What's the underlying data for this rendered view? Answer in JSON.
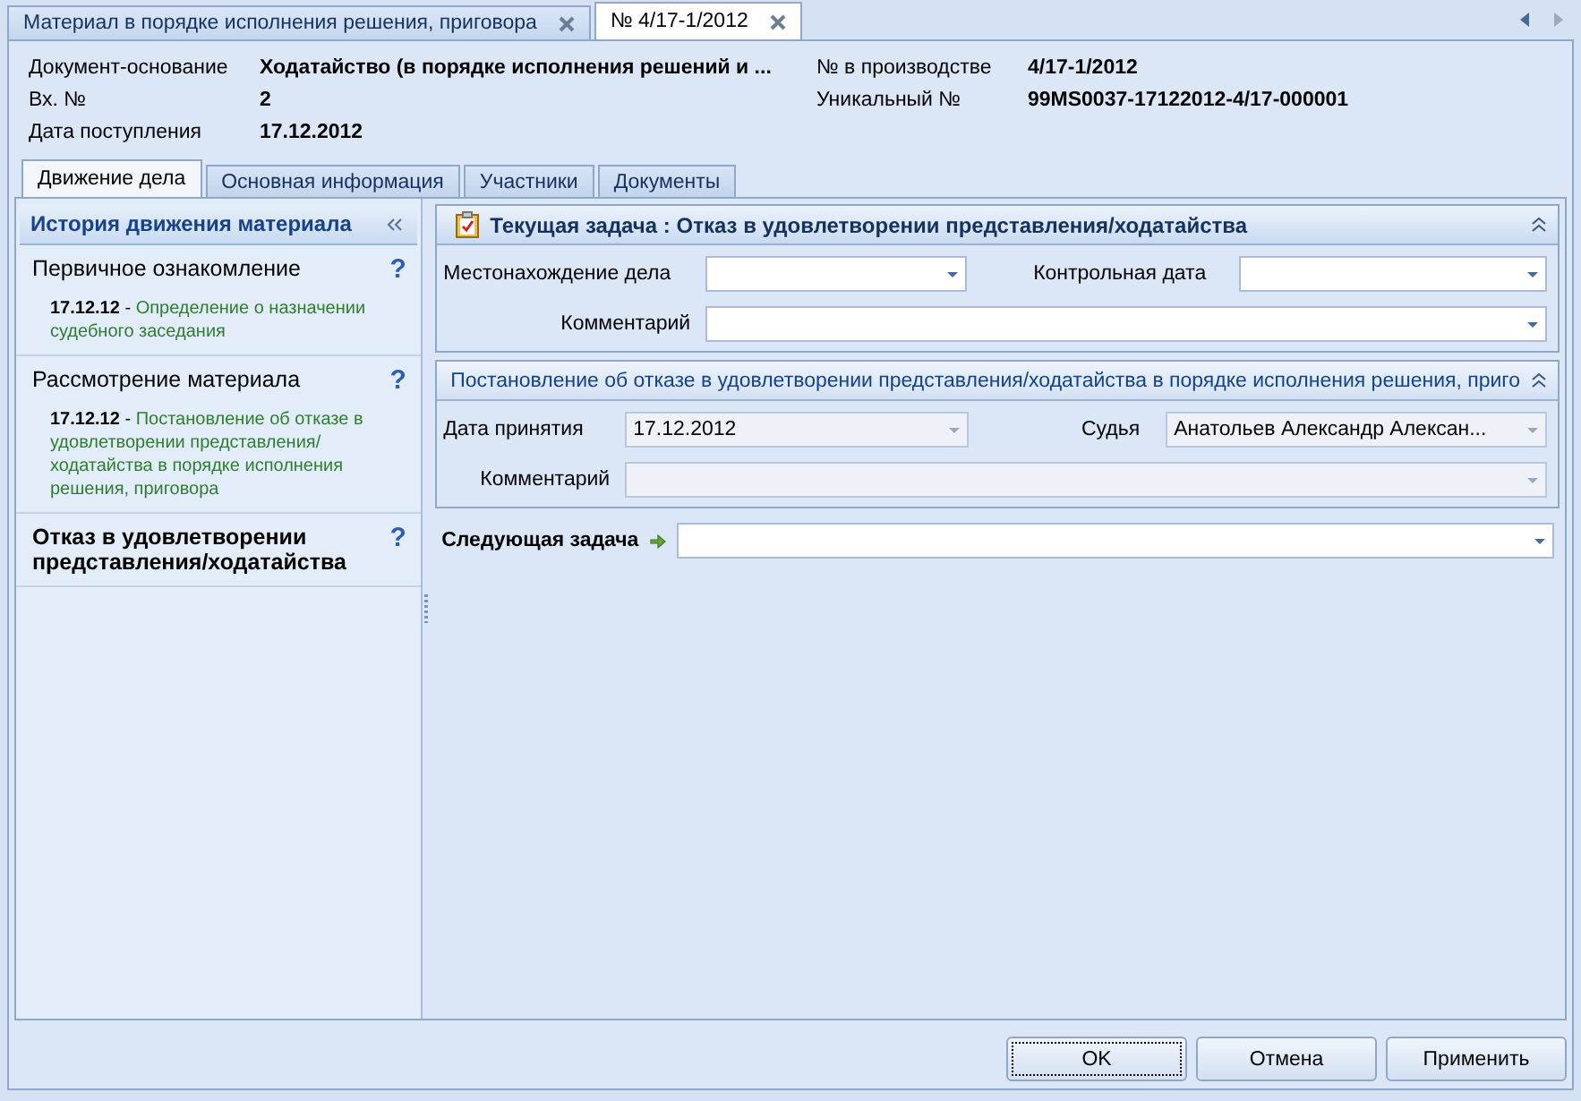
{
  "doc_tabs": [
    {
      "label": "Материал в порядке исполнения решения, приговора",
      "selected": false
    },
    {
      "label": "№ 4/17-1/2012",
      "selected": true
    }
  ],
  "header": {
    "left": [
      {
        "label": "Документ-основание",
        "value": "Ходатайство (в порядке исполнения решений и ..."
      },
      {
        "label": "Вх. №",
        "value": "2"
      },
      {
        "label": "Дата поступления",
        "value": "17.12.2012"
      }
    ],
    "right": [
      {
        "label": "№ в производстве",
        "value": "4/17-1/2012"
      },
      {
        "label": "Уникальный №",
        "value": "99MS0037-17122012-4/17-000001"
      }
    ]
  },
  "tabs": [
    {
      "label": "Движение дела",
      "selected": true
    },
    {
      "label": "Основная информация",
      "selected": false
    },
    {
      "label": "Участники",
      "selected": false
    },
    {
      "label": "Документы",
      "selected": false
    }
  ],
  "history": {
    "title": "История движения материала",
    "items": [
      {
        "title": "Первичное ознакомление",
        "current": false,
        "help": "?",
        "date": "17.12.12",
        "separator": "-",
        "text": "Определение о назначении судебного заседания"
      },
      {
        "title": "Рассмотрение материала",
        "current": false,
        "help": "?",
        "date": "17.12.12",
        "separator": "-",
        "text": "Постановление об отказе в удовлетворении представления/ходатайства в порядке исполнения решения, приговора"
      },
      {
        "title": "Отказ в удовлетворении представления/ходатайства",
        "current": true,
        "help": "?"
      }
    ]
  },
  "current_task": {
    "title": "Текущая задача : Отказ в удовлетворении представления/ходатайства",
    "location_label": "Местонахождение дела",
    "control_date_label": "Контрольная дата",
    "comment_label": "Комментарий"
  },
  "decision": {
    "title": "Постановление об отказе в удовлетворении представления/ходатайства в порядке исполнения решения, приго",
    "date_label": "Дата принятия",
    "date_value": "17.12.2012",
    "judge_label": "Судья",
    "judge_value": "Анатольев Александр Алексан...",
    "comment_label": "Комментарий",
    "disabled": true
  },
  "next_task": {
    "label": "Следующая задача"
  },
  "buttons": [
    {
      "label": "OK",
      "selected": true
    },
    {
      "label": "Отмена",
      "selected": false
    },
    {
      "label": "Применить",
      "selected": false
    }
  ]
}
